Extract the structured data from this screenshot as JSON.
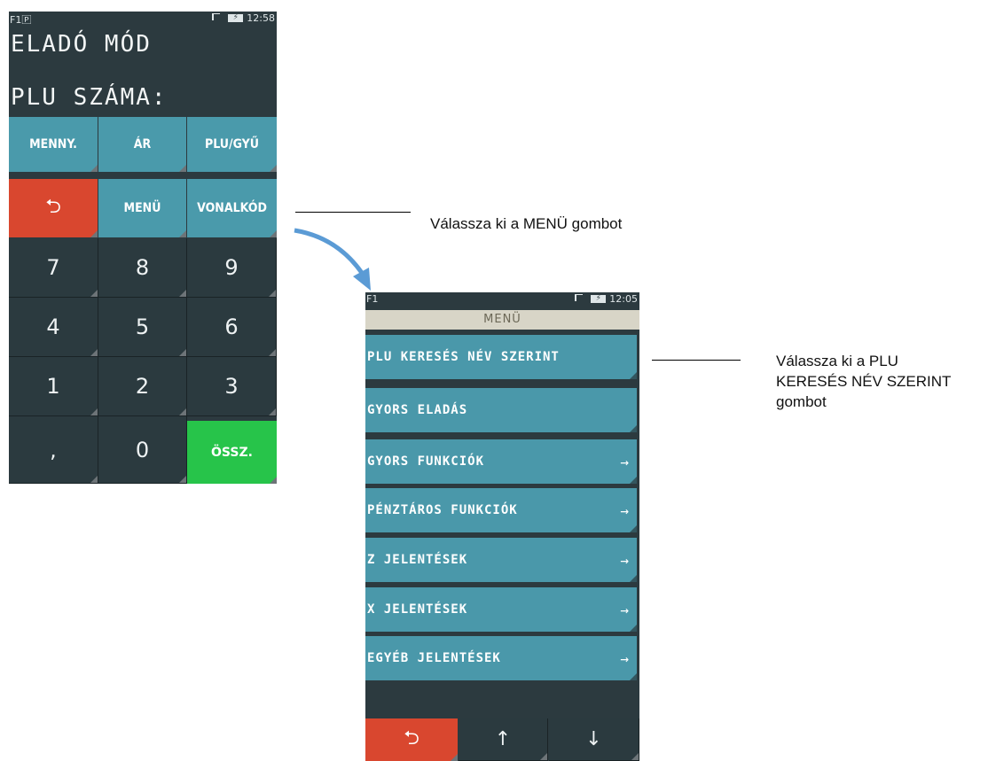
{
  "screen1": {
    "status_left": "F1🄿",
    "status_time": "12:58",
    "battery_icon": "battery-charging-icon",
    "signal_icon": "signal-icon",
    "title": "ELADÓ MÓD",
    "prompt": "PLU SZÁMA:",
    "function_keys": [
      "MENNY.",
      "ÁR",
      "PLU/GYŰ",
      "MENÜ",
      "VONALKÓD"
    ],
    "back_symbol": "⮌",
    "numpad": [
      "7",
      "8",
      "9",
      "4",
      "5",
      "6",
      "1",
      "2",
      "3",
      ",",
      "0"
    ],
    "total_label": "ÖSSZ.",
    "colors": {
      "teal": "#4a9aab",
      "red": "#d9472f",
      "green": "#27c44a",
      "bg": "#2c3a3f"
    }
  },
  "screen2": {
    "status_left": "F1",
    "status_time": "12:05",
    "title": "MENÜ",
    "items": [
      {
        "label": "PLU KERESÉS NÉV SZERINT",
        "arrow": ""
      },
      {
        "label": "GYORS ELADÁS",
        "arrow": ""
      },
      {
        "label": "GYORS FUNKCIÓK",
        "arrow": "→"
      },
      {
        "label": "PÉNZTÁROS FUNKCIÓK",
        "arrow": "→"
      },
      {
        "label": "Z JELENTÉSEK",
        "arrow": "→"
      },
      {
        "label": "X JELENTÉSEK",
        "arrow": "→"
      },
      {
        "label": "EGYÉB JELENTÉSEK",
        "arrow": "→"
      }
    ],
    "back_symbol": "⮌",
    "up_symbol": "↑",
    "down_symbol": "↓"
  },
  "annotations": {
    "first": "Válassza ki a MENÜ gombot",
    "second_line1": "Válassza ki a PLU",
    "second_line2": "KERESÉS NÉV SZERINT",
    "second_line3": "gombot"
  }
}
